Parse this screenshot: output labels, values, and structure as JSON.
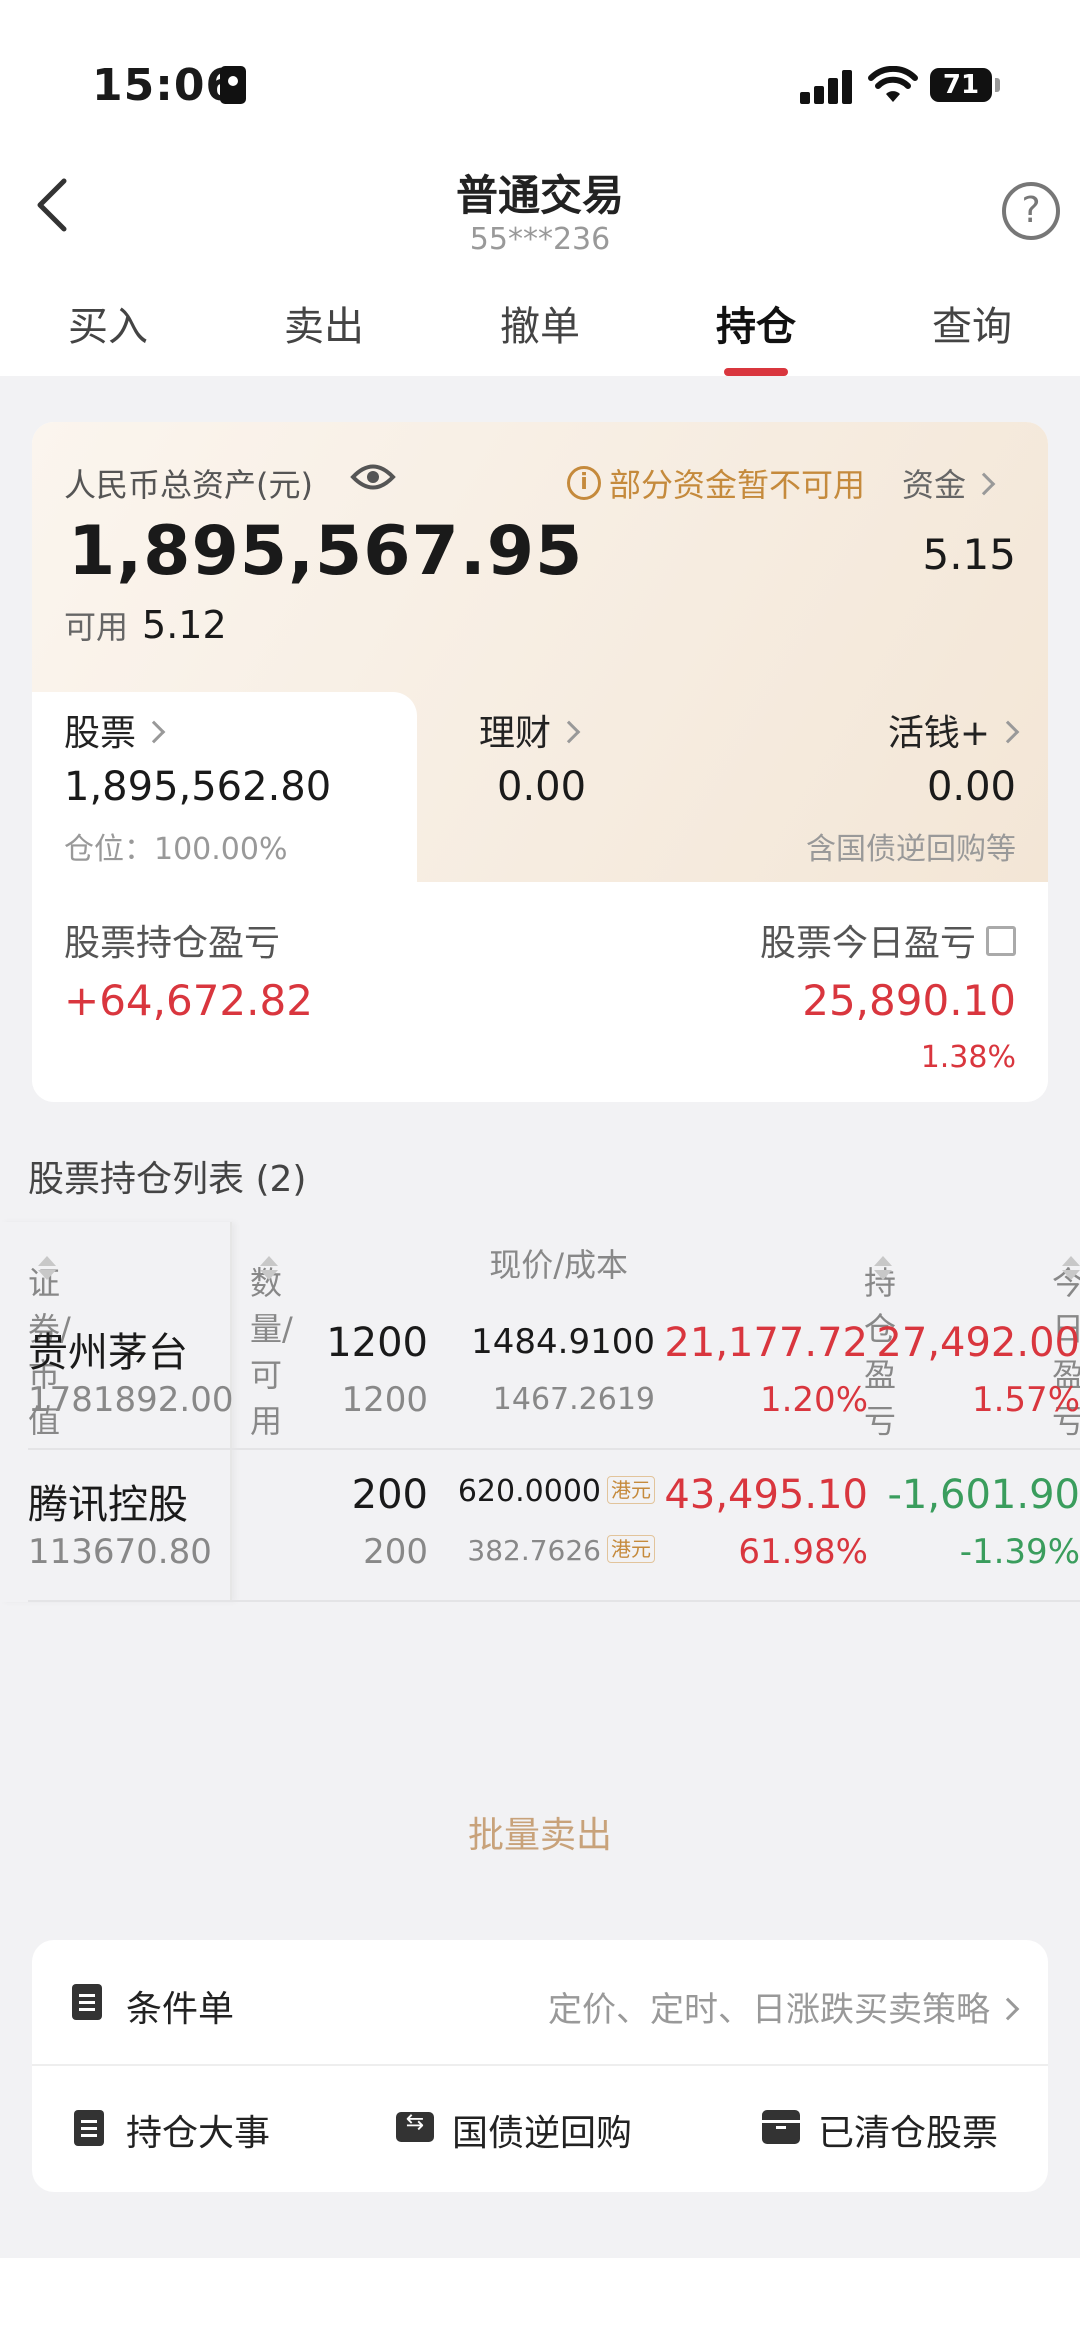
{
  "status": {
    "time": "15:06",
    "battery": "71"
  },
  "header": {
    "title": "普通交易",
    "account": "55***236",
    "help": "?"
  },
  "tabs": [
    "买入",
    "卖出",
    "撤单",
    "持仓",
    "查询"
  ],
  "asset": {
    "label": "人民币总资产(元)",
    "notice": "部分资金暂不可用",
    "fund_link": "资金",
    "total": "1,895,567.95",
    "right_value": "5.15",
    "available_label": "可用",
    "available_value": "5.12",
    "stocks": {
      "label": "股票",
      "value": "1,895,562.80",
      "note": "仓位：100.00%"
    },
    "wealth": {
      "label": "理财",
      "value": "0.00"
    },
    "cash_plus": {
      "label": "活钱+",
      "value": "0.00",
      "note": "含国债逆回购等"
    },
    "holding_pl_label": "股票持仓盈亏",
    "holding_pl_value": "+64,672.82",
    "today_pl_label": "股票今日盈亏",
    "today_pl_value": "25,890.10",
    "today_pl_pct": "1.38%"
  },
  "list": {
    "title": "股票持仓列表 (2)",
    "headers": {
      "security": "证券/市值",
      "qty": "数量/可用",
      "price": "现价/成本",
      "pl": "持仓盈亏",
      "today": "今日盈亏"
    },
    "rows": [
      {
        "name": "贵州茅台",
        "market_value": "1781892.00",
        "qty": "1200",
        "avail": "1200",
        "price": "1484.9100",
        "cost": "1467.2619",
        "pl": "21,177.72",
        "pl_pct": "1.20%",
        "today": "27,492.00",
        "today_pct": "1.57%",
        "currency": ""
      },
      {
        "name": "腾讯控股",
        "market_value": "113670.80",
        "qty": "200",
        "avail": "200",
        "price": "620.0000",
        "cost": "382.7626",
        "pl": "43,495.10",
        "pl_pct": "61.98%",
        "today": "-1,601.90",
        "today_pct": "-1.39%",
        "currency": "港元"
      }
    ]
  },
  "batch_sell": "批量卖出",
  "tools": {
    "conditional": {
      "label": "条件单",
      "desc": "定价、定时、日涨跌买卖策略"
    },
    "events": "持仓大事",
    "repo": "国债逆回购",
    "cleared": "已清仓股票"
  },
  "colors": {
    "up": "#d9363e",
    "down": "#3a9d5d",
    "accent": "#c58a3c"
  }
}
